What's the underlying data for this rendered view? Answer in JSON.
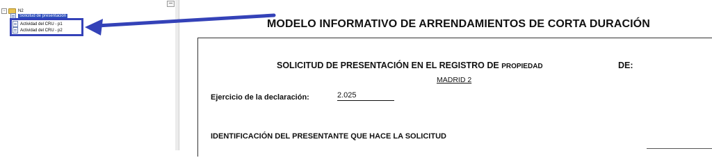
{
  "tree": {
    "root_label": "N2",
    "root_expander": "−",
    "parent_label": "Solicitud de presentación",
    "children": [
      {
        "label": "Actividad del CRU - p1"
      },
      {
        "label": "Actividad del CRU - p2"
      }
    ],
    "collapse_button": "−"
  },
  "document": {
    "title": "MODELO INFORMATIVO DE ARRENDAMIENTOS DE CORTA DURACIÓN",
    "request_title_main": "SOLICITUD DE PRESENTACIÓN EN EL REGISTRO DE ",
    "request_title_small": "PROPIEDAD",
    "de_label": "DE:",
    "registry_name": "MADRID 2",
    "exercise_label": "Ejercicio de la declaración:",
    "exercise_value": "2.025",
    "section_heading": "IDENTIFICACIÓN DEL PRESENTANTE QUE HACE LA SOLICITUD"
  },
  "colors": {
    "highlight": "#3442b8",
    "selection": "#2e4fbd"
  },
  "icons": [
    "folder-icon",
    "document-icon",
    "arrow-icon"
  ]
}
